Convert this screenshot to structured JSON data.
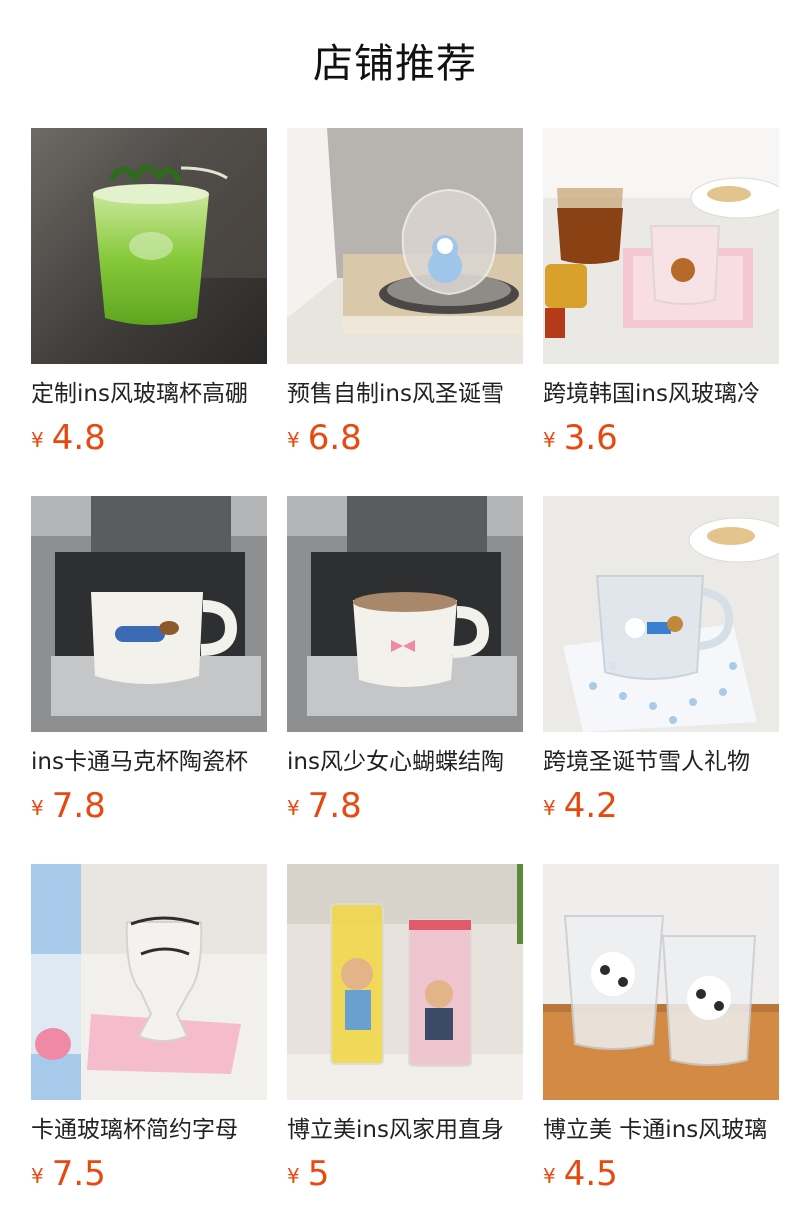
{
  "page_title": "店铺推荐",
  "currency_symbol": "¥",
  "accent_color": "#e8490f",
  "products": [
    {
      "name": "定制ins风玻璃杯高硼",
      "price": "4.8",
      "image": "green-drink-glass-photo"
    },
    {
      "name": "预售自制ins风圣诞雪",
      "price": "6.8",
      "image": "snowman-glass-bowl-photo"
    },
    {
      "name": "跨境韩国ins风玻璃冷",
      "price": "3.6",
      "image": "bear-glass-mug-photo"
    },
    {
      "name": "ins卡通马克杯陶瓷杯",
      "price": "7.8",
      "image": "dachshund-ceramic-mug-photo"
    },
    {
      "name": "ins风少女心蝴蝶结陶",
      "price": "7.8",
      "image": "bow-ceramic-mug-photo"
    },
    {
      "name": "跨境圣诞节雪人礼物",
      "price": "4.2",
      "image": "snowman-glass-mug-photo"
    },
    {
      "name": "卡通玻璃杯简约字母",
      "price": "7.5",
      "image": "letter-goblet-glass-photo"
    },
    {
      "name": "博立美ins风家用直身",
      "price": "5",
      "image": "cartoon-tall-glasses-photo"
    },
    {
      "name": "博立美 卡通ins风玻璃",
      "price": "4.5",
      "image": "puppy-tumbler-glasses-photo"
    }
  ]
}
